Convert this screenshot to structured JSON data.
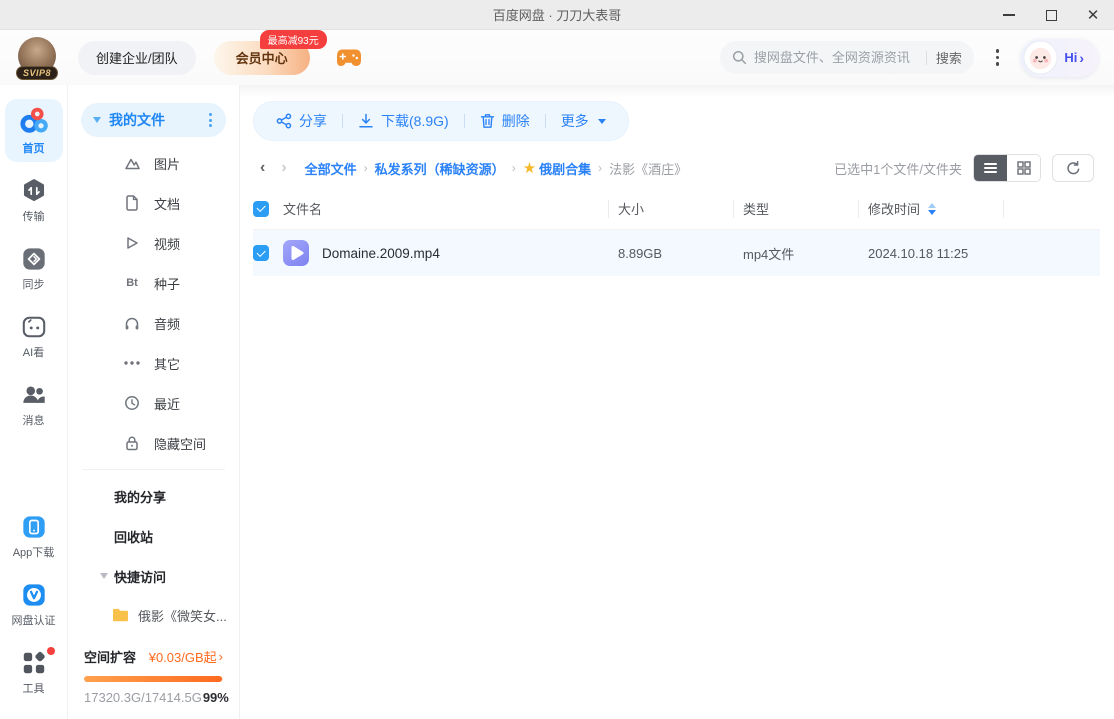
{
  "titlebar": {
    "title": "百度网盘 · 刀刀大表哥"
  },
  "header": {
    "avatar_badge": "SVIP8",
    "create_team_label": "创建企业/团队",
    "vip_center_label": "会员中心",
    "vip_badge": "最高减93元",
    "search_placeholder": "搜网盘文件、全网资源资讯",
    "search_button_label": "搜索",
    "assistant_label": "Hi"
  },
  "nav": {
    "items": [
      {
        "label": "首页"
      },
      {
        "label": "传输"
      },
      {
        "label": "同步"
      },
      {
        "label": "AI看"
      },
      {
        "label": "消息"
      }
    ],
    "bottom_items": [
      {
        "label": "App下载"
      },
      {
        "label": "网盘认证"
      },
      {
        "label": "工具"
      }
    ]
  },
  "tree": {
    "my_files": "我的文件",
    "items": [
      {
        "label": "图片"
      },
      {
        "label": "文档"
      },
      {
        "label": "视频"
      },
      {
        "label": "种子"
      },
      {
        "label": "音频"
      },
      {
        "label": "其它"
      },
      {
        "label": "最近"
      },
      {
        "label": "隐藏空间"
      }
    ],
    "bt_glyph": "Bt",
    "my_shares": "我的分享",
    "recycle_bin": "回收站",
    "quick_access": "快捷访问",
    "quick_folder": "俄影《微笑女...",
    "storage": {
      "expand_label": "空间扩容",
      "price": "¥0.03/GB起",
      "usage": "17320.3G/17414.5G",
      "percent_label": "99%",
      "percent_value": 99
    }
  },
  "toolbar": {
    "share": "分享",
    "download": "下载(8.9G)",
    "delete": "删除",
    "more": "更多"
  },
  "breadcrumb": {
    "items": [
      {
        "label": "全部文件"
      },
      {
        "label": "私发系列（稀缺资源）"
      },
      {
        "label": "俄剧合集"
      },
      {
        "label": "法影《酒庄》"
      }
    ],
    "selection_info": "已选中1个文件/文件夹"
  },
  "table": {
    "columns": [
      {
        "label": "文件名"
      },
      {
        "label": "大小"
      },
      {
        "label": "类型"
      },
      {
        "label": "修改时间"
      }
    ],
    "rows": [
      {
        "name": "Domaine.2009.mp4",
        "size": "8.89GB",
        "type": "mp4文件",
        "time": "2024.10.18 11:25"
      }
    ]
  },
  "colors": {
    "accent_blue": "#2b82f7",
    "orange": "#ff6a1f",
    "badge_red": "#f53f3f",
    "folder_yellow": "#f7c14b",
    "selected_row": "#f3f9fe"
  }
}
